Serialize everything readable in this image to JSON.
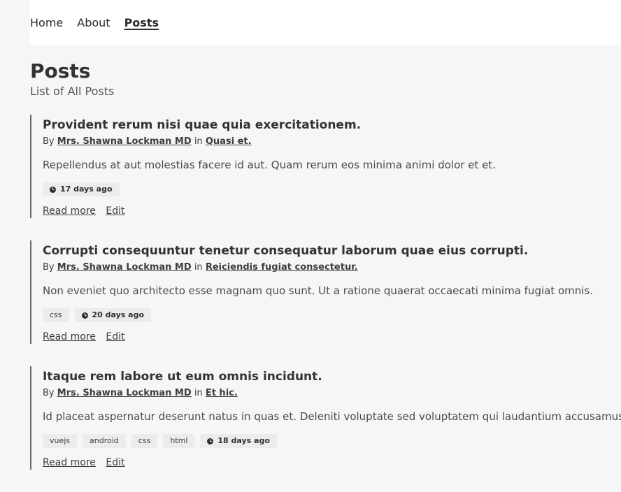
{
  "nav": {
    "items": [
      {
        "label": "Home",
        "active": false
      },
      {
        "label": "About",
        "active": false
      },
      {
        "label": "Posts",
        "active": true
      }
    ]
  },
  "page": {
    "title": "Posts",
    "subtitle": "List of All Posts"
  },
  "posts": [
    {
      "title": "Provident rerum nisi quae quia exercitationem.",
      "by_label": "By",
      "author": "Mrs. Shawna Lockman MD",
      "in_label": "in",
      "category": "Quasi et.",
      "excerpt": "Repellendus at aut molestias facere id aut. Quam rerum eos minima animi dolor et et.",
      "tags": [],
      "time": "17 days ago",
      "read_more": "Read more",
      "edit": "Edit"
    },
    {
      "title": "Corrupti consequuntur tenetur consequatur laborum quae eius corrupti.",
      "by_label": "By",
      "author": "Mrs. Shawna Lockman MD",
      "in_label": "in",
      "category": "Reiciendis fugiat consectetur.",
      "excerpt": "Non eveniet quo architecto esse magnam quo sunt. Ut a ratione quaerat occaecati minima fugiat omnis.",
      "tags": [
        "css"
      ],
      "time": "20 days ago",
      "read_more": "Read more",
      "edit": "Edit"
    },
    {
      "title": "Itaque rem labore ut eum omnis incidunt.",
      "by_label": "By",
      "author": "Mrs. Shawna Lockman MD",
      "in_label": "in",
      "category": "Et hic.",
      "excerpt": "Id placeat aspernatur deserunt natus in quas et. Deleniti voluptate sed voluptatem qui laudantium accusamus.",
      "tags": [
        "vuejs",
        "android",
        "css",
        "html"
      ],
      "time": "18 days ago",
      "read_more": "Read more",
      "edit": "Edit"
    }
  ]
}
